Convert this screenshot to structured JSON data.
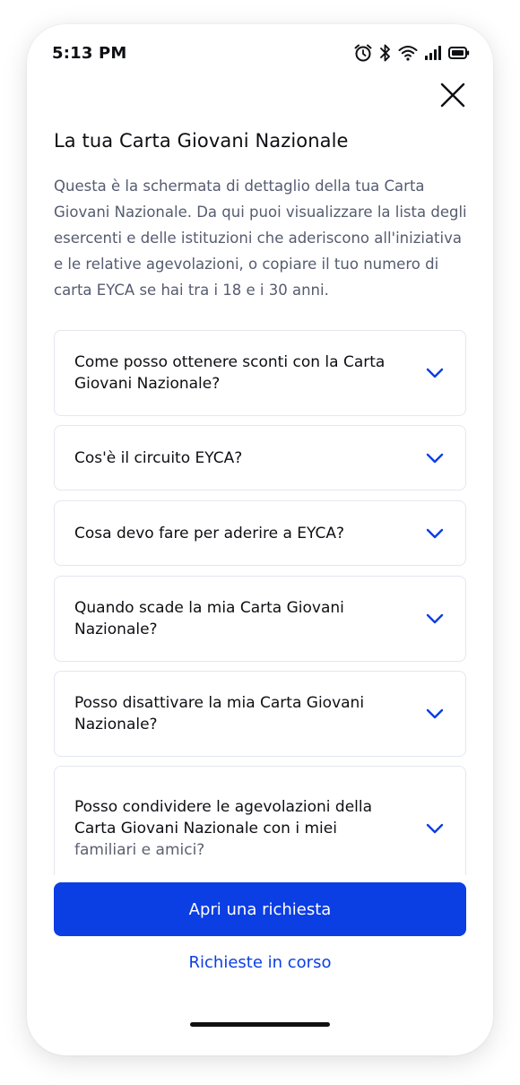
{
  "status_bar": {
    "time": "5:13 PM",
    "icons": [
      "alarm-icon",
      "bluetooth-icon",
      "wifi-icon",
      "signal-icon",
      "battery-icon"
    ]
  },
  "header": {
    "close_icon": "close-icon",
    "title": "La tua Carta Giovani Nazionale",
    "description": "Questa è la schermata di dettaglio della tua Carta Giovani Nazionale. Da qui puoi visualizzare la lista degli esercenti e delle istituzioni che aderiscono all'iniziativa e le relative agevolazioni, o copiare il tuo numero di carta EYCA se hai tra i 18 e i 30 anni."
  },
  "faq": {
    "items": [
      {
        "question": "Come posso ottenere sconti con la Carta Giovani Nazionale?"
      },
      {
        "question": "Cos'è il circuito EYCA?"
      },
      {
        "question": "Cosa devo fare per aderire a EYCA?"
      },
      {
        "question": "Quando scade la mia Carta Giovani Nazionale?"
      },
      {
        "question": "Posso disattivare la mia Carta Giovani Nazionale?"
      },
      {
        "question": "Posso condividere le agevolazioni della Carta Giovani Nazionale con i miei",
        "question_faded": "familiari e amici?"
      }
    ]
  },
  "actions": {
    "primary_label": "Apri una richiesta",
    "secondary_label": "Richieste in corso"
  },
  "colors": {
    "accent": "#0b3ee3",
    "text_primary": "#0e0f13",
    "text_secondary": "#555c70",
    "border": "#e3e7ee"
  }
}
